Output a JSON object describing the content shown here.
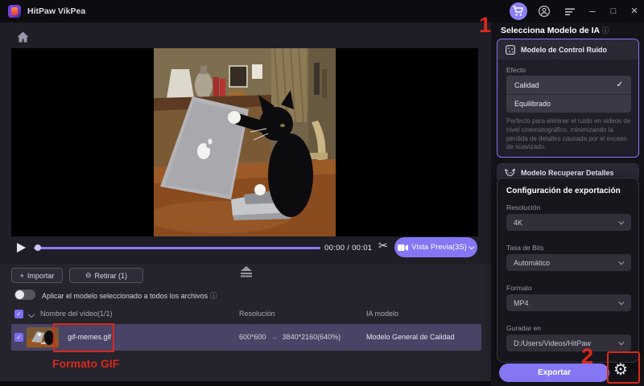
{
  "colors": {
    "accent": "#8577f3",
    "annotation_red": "#d9291c",
    "row_highlight": "#494466"
  },
  "icons": {
    "scissors": "✂",
    "gear": "⚙",
    "info": "ⓘ",
    "check": "✓",
    "arrow": "→",
    "plus": "+",
    "remove_circle": "⊖",
    "minimize": "–",
    "maximize": "□",
    "close": "✕"
  },
  "titlebar": {
    "app_title": "HitPaw VikPea"
  },
  "player": {
    "time": "00:00 / 00:01",
    "preview_button_label": "Vista Previa(3S)"
  },
  "file_panel": {
    "import_label": "Importar",
    "remove_label": "Retirar (1)",
    "toggle_label": "Aplicar el modelo seleccionado a todos los archivos",
    "table": {
      "columns": [
        "Nombre del vídeo(1/1)",
        "Resolución",
        "IA modelo"
      ],
      "row": {
        "name": "gif-memes.gif",
        "resolution_from": "600*600",
        "resolution_to": "3840*2160(640%)",
        "model": "Modelo General de Calidad"
      }
    }
  },
  "annotations": {
    "step1": "1",
    "step2": "2",
    "formato_gif": "Formato GIF"
  },
  "right_panel": {
    "title": "Selecciona Modelo de IA",
    "noise_model": {
      "title": "Modelo de Control Ruido",
      "effect_label": "Efecto",
      "options": [
        {
          "label": "Calidad",
          "selected": true
        },
        {
          "label": "Equilibrado",
          "selected": false
        }
      ],
      "description": "Perfecto para eliminar el ruido en videos de nivel cinematográfico, minimizando la pérdida de detalles causada por el exceso de suavizado."
    },
    "detail_model": {
      "title": "Modelo Recuperar Detalles"
    },
    "export_config": {
      "title": "Configuración de exportación",
      "fields": [
        {
          "label": "Resolución",
          "value": "4K"
        },
        {
          "label": "Tasa de Bits",
          "value": "Automático"
        },
        {
          "label": "Formato",
          "value": "MP4"
        },
        {
          "label": "Guradar en",
          "value": "D:/Users/Videos/HitPaw"
        }
      ]
    },
    "export_button": "Exportar"
  }
}
